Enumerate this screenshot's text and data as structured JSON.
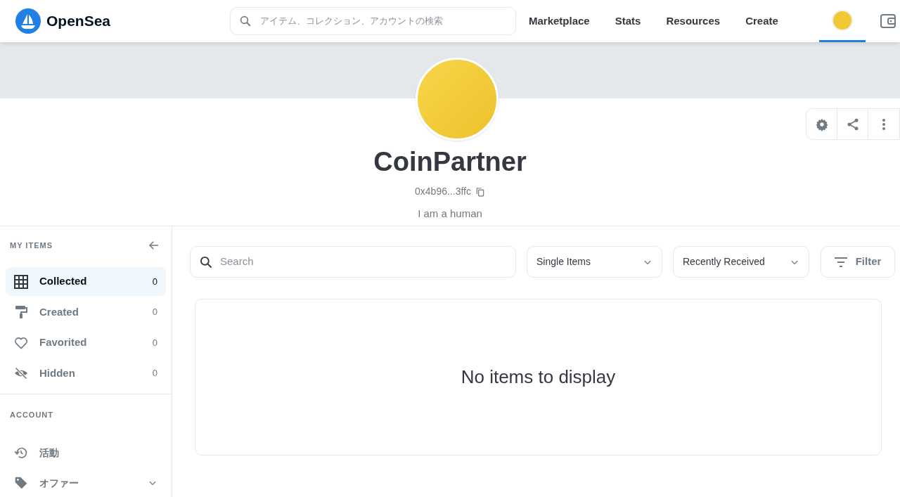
{
  "header": {
    "logo_text": "OpenSea",
    "search": {
      "placeholder": "アイテム、コレクション、アカウントの検索"
    },
    "nav": [
      {
        "label": "Marketplace"
      },
      {
        "label": "Stats"
      },
      {
        "label": "Resources"
      },
      {
        "label": "Create"
      }
    ],
    "profile_selected": true
  },
  "profile": {
    "name": "CoinPartner",
    "address": "0x4b96...3ffc",
    "bio": "I am a human"
  },
  "sidebar": {
    "my_items_title": "MY ITEMS",
    "items": [
      {
        "label": "Collected",
        "count": "0",
        "selected": true
      },
      {
        "label": "Created",
        "count": "0",
        "selected": false
      },
      {
        "label": "Favorited",
        "count": "0",
        "selected": false
      },
      {
        "label": "Hidden",
        "count": "0",
        "selected": false
      }
    ],
    "account_title": "ACCOUNT",
    "account_items": [
      {
        "label": "活動",
        "expandable": false
      },
      {
        "label": "オファー",
        "expandable": true
      }
    ]
  },
  "toolbar": {
    "search": {
      "placeholder": "Search"
    },
    "type_select": "Single Items",
    "sort_select": "Recently Received",
    "filter_button": "Filter"
  },
  "empty_message": "No items to display"
}
